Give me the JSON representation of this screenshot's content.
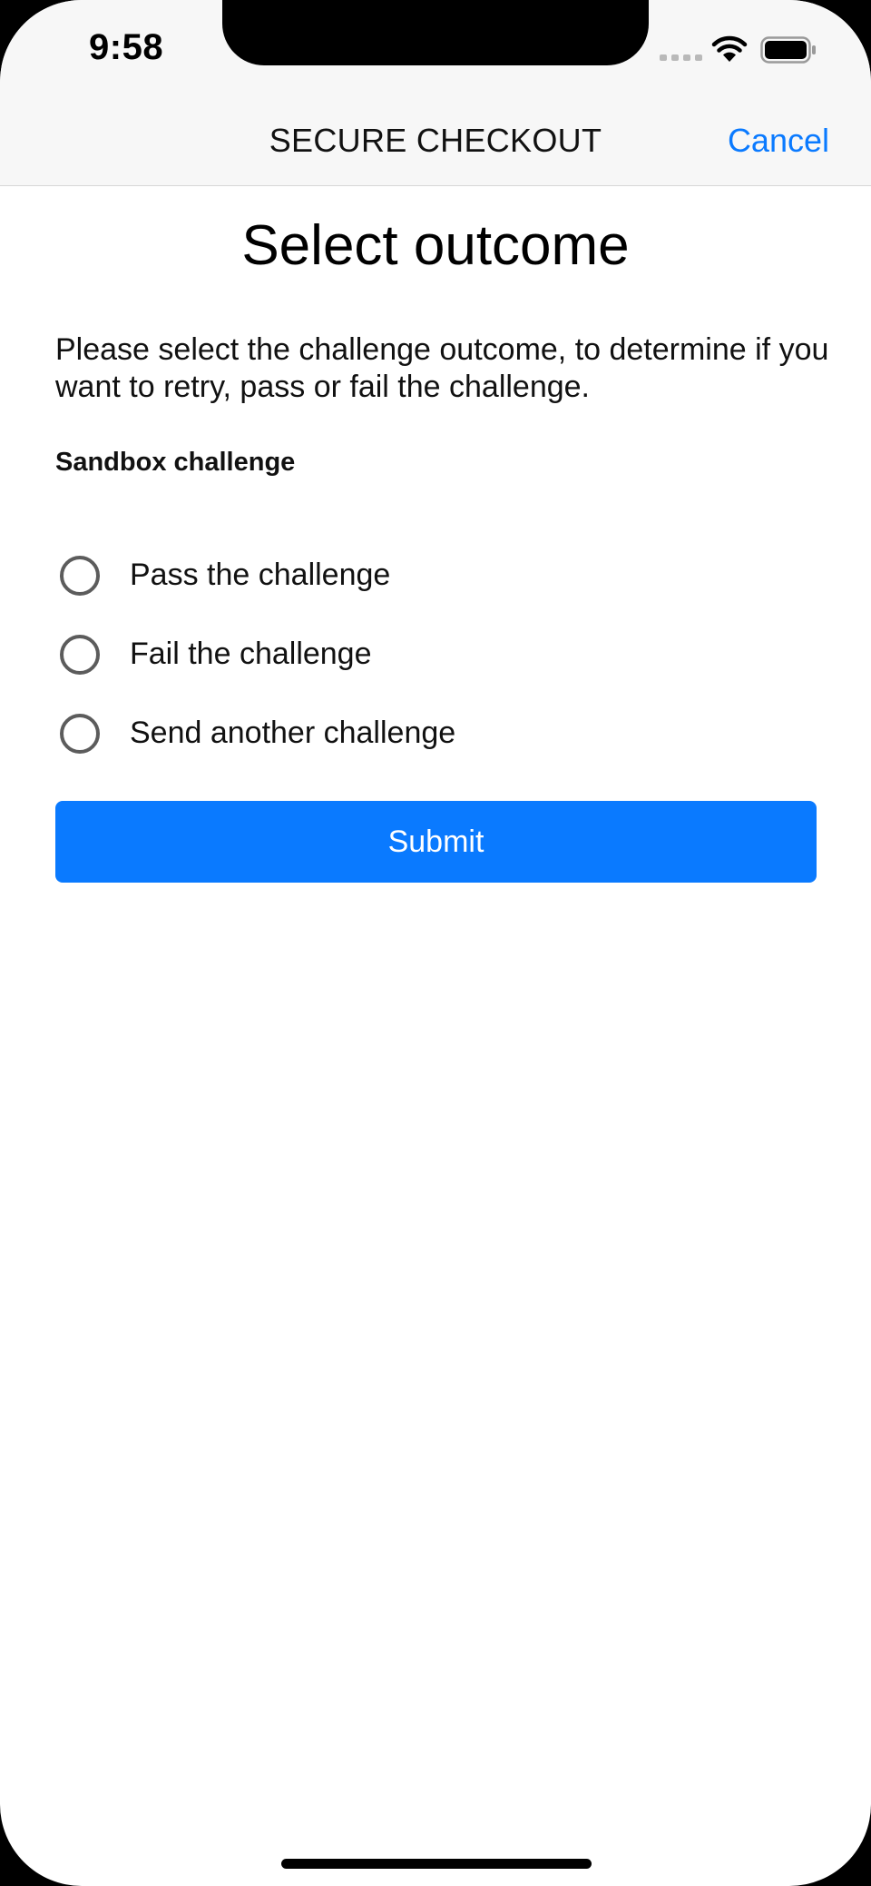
{
  "status_bar": {
    "time": "9:58",
    "icons": [
      "signal-icon",
      "wifi-icon",
      "battery-icon"
    ]
  },
  "nav": {
    "title": "SECURE CHECKOUT",
    "cancel_label": "Cancel"
  },
  "page": {
    "title": "Select outcome",
    "instructions": "Please select the challenge outcome, to determine if you want to retry, pass or fail the challenge.",
    "section_label": "Sandbox challenge"
  },
  "options": [
    {
      "label": "Pass the challenge",
      "selected": false
    },
    {
      "label": "Fail the challenge",
      "selected": false
    },
    {
      "label": "Send another challenge",
      "selected": false
    }
  ],
  "submit_label": "Submit",
  "colors": {
    "accent": "#0a7aff",
    "radio_border": "#5c5c5c",
    "bar_background": "#f7f7f7"
  }
}
